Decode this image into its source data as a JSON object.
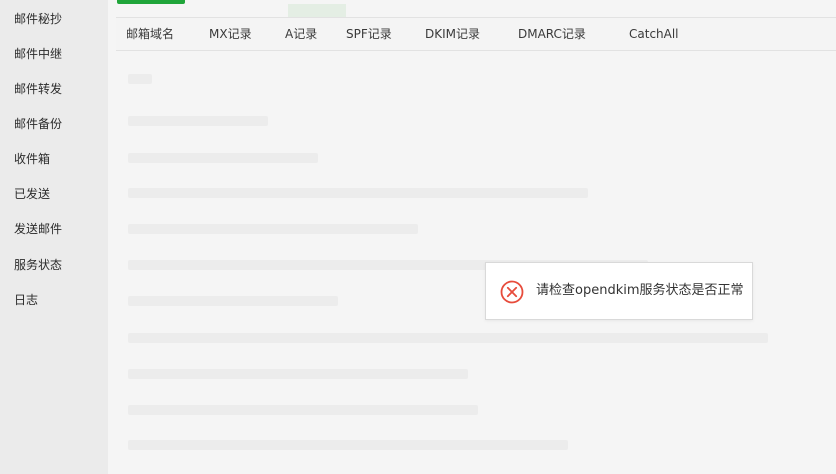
{
  "sidebar": {
    "items": [
      {
        "label": "邮件秘抄"
      },
      {
        "label": "邮件中继"
      },
      {
        "label": "邮件转发"
      },
      {
        "label": "邮件备份"
      },
      {
        "label": "收件箱"
      },
      {
        "label": "已发送"
      },
      {
        "label": "发送邮件"
      },
      {
        "label": "服务状态"
      },
      {
        "label": "日志"
      }
    ]
  },
  "table": {
    "columns": [
      "邮箱域名",
      "MX记录",
      "A记录",
      "SPF记录",
      "DKIM记录",
      "DMARC记录",
      "CatchAll"
    ]
  },
  "toast": {
    "message": "请检查opendkim服务状态是否正常",
    "icon": "error-circle-icon",
    "color": "#e74c3c"
  },
  "colors": {
    "accent": "#20a53a"
  }
}
